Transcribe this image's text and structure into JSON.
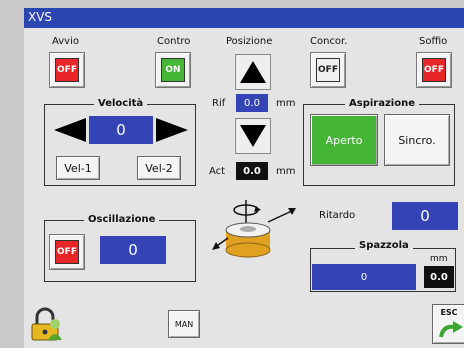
{
  "window": {
    "title": "XVS"
  },
  "top": {
    "avvio": {
      "label": "Avvio",
      "state": "OFF"
    },
    "contro": {
      "label": "Contro",
      "state": "ON"
    },
    "posizione": {
      "label": "Posizione"
    },
    "concor": {
      "label": "Concor.",
      "state": "OFF"
    },
    "soffio": {
      "label": "Soffio",
      "state": "OFF"
    }
  },
  "velocita": {
    "title": "Velocità",
    "value": "0",
    "vel1": "Vel-1",
    "vel2": "Vel-2"
  },
  "posizione": {
    "rif_label": "Rif",
    "rif_value": "0.0",
    "rif_unit": "mm",
    "act_label": "Act",
    "act_value": "0.0",
    "act_unit": "mm"
  },
  "aspirazione": {
    "title": "Aspirazione",
    "aperto": "Aperto",
    "sincro": "Sincro."
  },
  "oscillazione": {
    "title": "Oscillazione",
    "state": "OFF",
    "value": "0"
  },
  "ritardo": {
    "label": "Ritardo",
    "value": "0"
  },
  "spazzola": {
    "title": "Spazzola",
    "value": "0",
    "unit": "mm",
    "mm_value": "0.0"
  },
  "bottom": {
    "man": "MAN",
    "esc": "ESC"
  },
  "colors": {
    "title_bar": "#2b46b0",
    "field_blue": "#3444b6",
    "off_red": "#e8262a",
    "on_green": "#44b534"
  }
}
